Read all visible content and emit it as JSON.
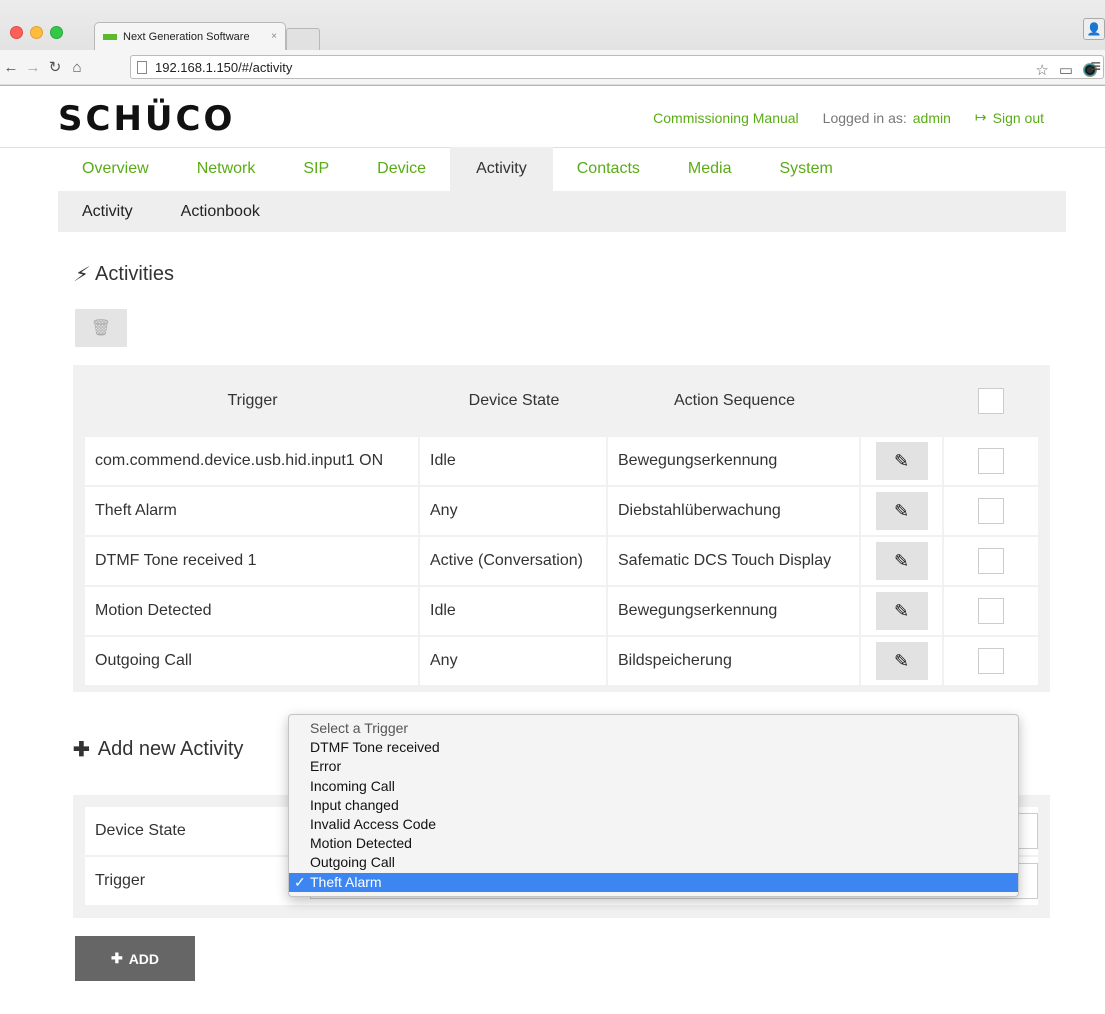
{
  "browser": {
    "tab_title": "Next Generation Software",
    "tab_close": "×",
    "url": "192.168.1.150/#/activity"
  },
  "header": {
    "logo": "SCHÜCO",
    "manual_link": "Commissioning Manual",
    "logged_in_label": "Logged in as:",
    "user": "admin",
    "sign_out": "Sign out"
  },
  "main_tabs": [
    "Overview",
    "Network",
    "SIP",
    "Device",
    "Activity",
    "Contacts",
    "Media",
    "System"
  ],
  "sub_tabs": [
    "Activity",
    "Actionbook"
  ],
  "activities": {
    "title": "Activities",
    "columns": [
      "Trigger",
      "Device State",
      "Action Sequence"
    ],
    "rows": [
      {
        "trigger": "com.commend.device.usb.hid.input1 ON",
        "state": "Idle",
        "action": "Bewegungserkennung"
      },
      {
        "trigger": "Theft Alarm",
        "state": "Any",
        "action": "Diebstahlüberwachung"
      },
      {
        "trigger": "DTMF Tone received 1",
        "state": "Active (Conversation)",
        "action": "Safematic DCS Touch Display"
      },
      {
        "trigger": "Motion Detected",
        "state": "Idle",
        "action": "Bewegungserkennung"
      },
      {
        "trigger": "Outgoing Call",
        "state": "Any",
        "action": "Bildspeicherung"
      }
    ]
  },
  "add_activity": {
    "title": "Add new Activity",
    "device_state_label": "Device State",
    "trigger_label": "Trigger",
    "add_button": "ADD"
  },
  "trigger_dropdown": {
    "options": [
      "Select a Trigger",
      "DTMF Tone received",
      "Error",
      "Incoming Call",
      "Input changed",
      "Invalid Access Code",
      "Motion Detected",
      "Outgoing Call",
      "Theft Alarm"
    ],
    "selected": "Theft Alarm",
    "check": "✓"
  },
  "colors": {
    "accent_green": "#5aac16",
    "selection_blue": "#3d86f2",
    "add_button_bg": "#666666"
  }
}
